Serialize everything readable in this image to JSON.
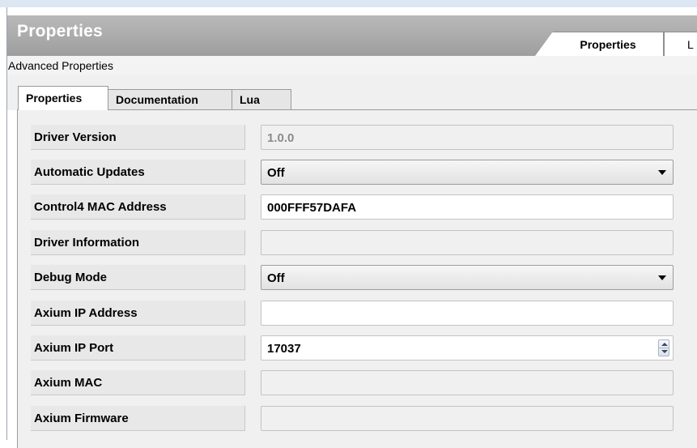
{
  "panel": {
    "title": "Properties",
    "top_tabs": [
      "Properties",
      "L"
    ],
    "subheader": "Advanced Properties"
  },
  "tabs": [
    "Properties",
    "Documentation",
    "Lua"
  ],
  "active_tab": "Properties",
  "properties": [
    {
      "label": "Driver Version",
      "value": "1.0.0",
      "type": "readonly"
    },
    {
      "label": "Automatic Updates",
      "value": "Off",
      "type": "dropdown"
    },
    {
      "label": "Control4 MAC Address",
      "value": "000FFF57DAFA",
      "type": "text"
    },
    {
      "label": "Driver Information",
      "value": "",
      "type": "readonly"
    },
    {
      "label": "Debug Mode",
      "value": "Off",
      "type": "dropdown"
    },
    {
      "label": "Axium IP Address",
      "value": "",
      "type": "text"
    },
    {
      "label": "Axium IP Port",
      "value": "17037",
      "type": "spinner"
    },
    {
      "label": "Axium MAC",
      "value": "",
      "type": "readonly"
    },
    {
      "label": "Axium Firmware",
      "value": "",
      "type": "readonly"
    }
  ],
  "icons": {
    "dropdown": "chevron-down-icon",
    "spinner": "spinner-arrows-icon"
  }
}
